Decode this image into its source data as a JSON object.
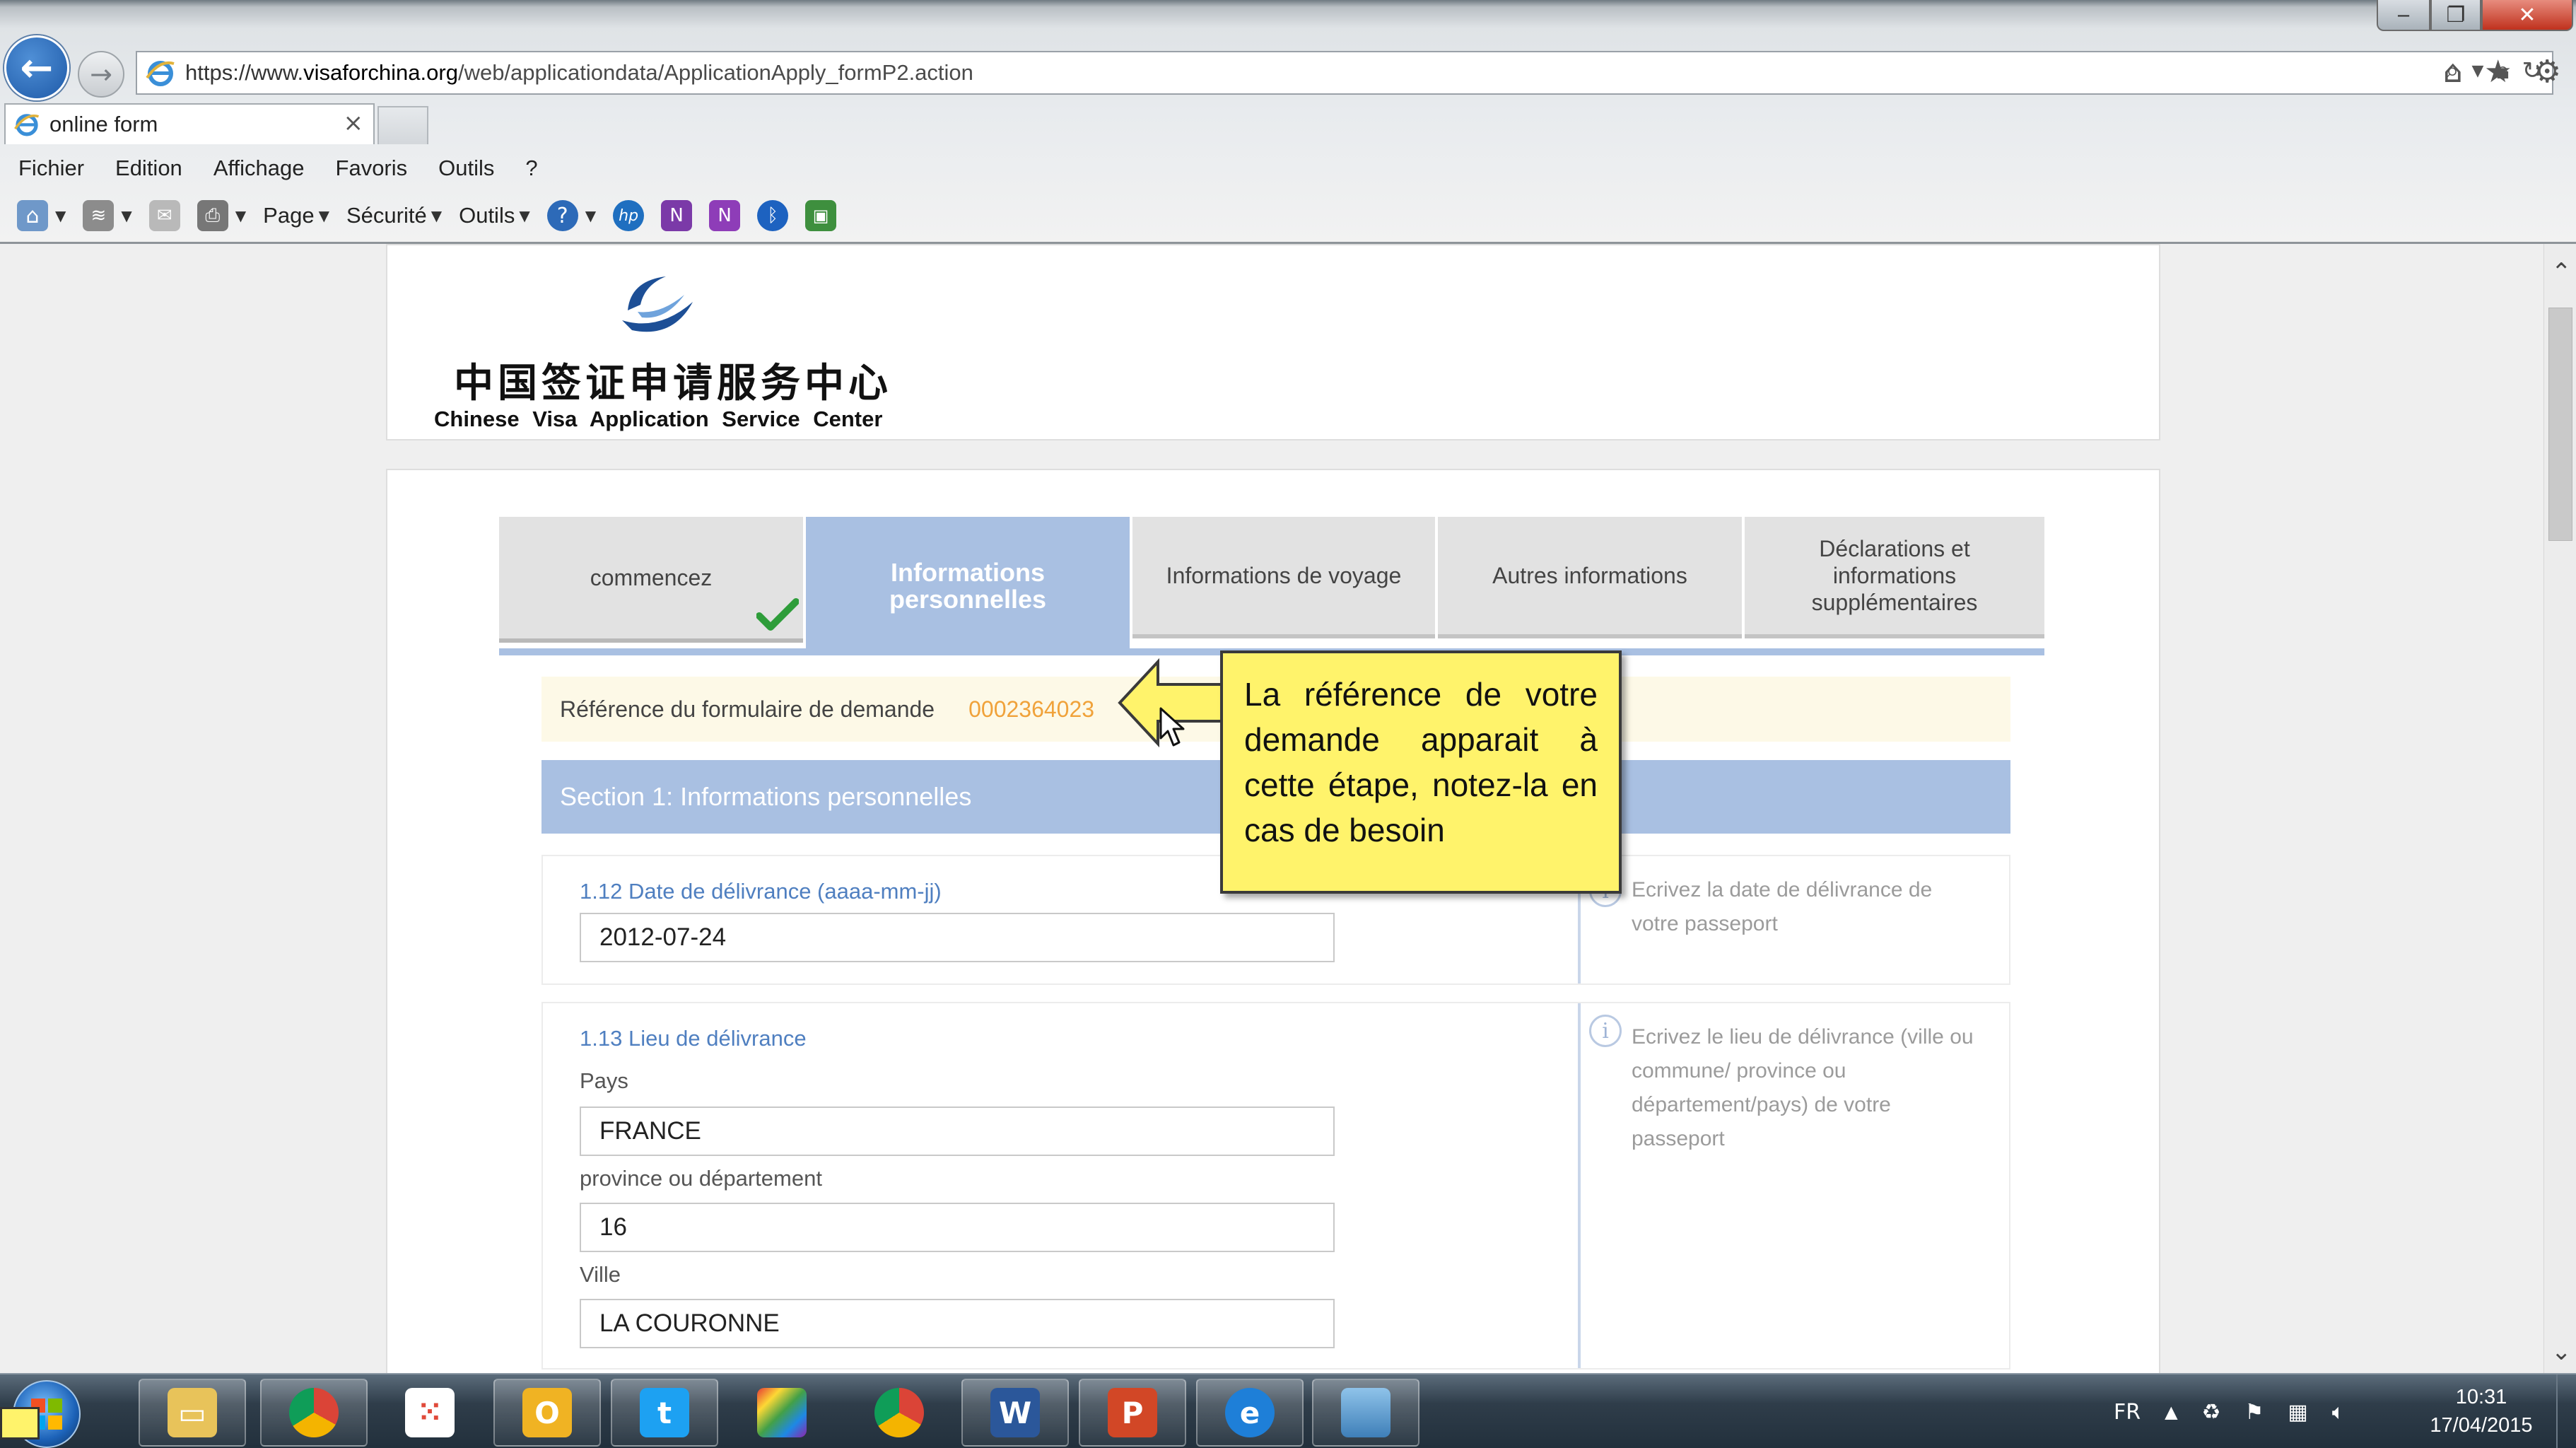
{
  "browser": {
    "url_prefix": "https://www.",
    "url_domain": "visaforchina.org",
    "url_path": "/web/applicationdata/ApplicationApply_formP2.action",
    "tab_title": "online form",
    "menu": [
      "Fichier",
      "Edition",
      "Affichage",
      "Favoris",
      "Outils",
      "?"
    ],
    "toolbar": {
      "page": "Page",
      "security": "Sécurité",
      "tools": "Outils"
    }
  },
  "header": {
    "logo_cn": "中国签证申请服务中心",
    "logo_en": "Chinese Visa Application Service Center"
  },
  "steps": [
    {
      "label": "commencez",
      "state": "done"
    },
    {
      "label": "Informations personnelles",
      "state": "active"
    },
    {
      "label": "Informations de voyage",
      "state": "pending"
    },
    {
      "label": "Autres informations",
      "state": "pending"
    },
    {
      "label": "Déclarations et informations supplémentaires",
      "state": "pending"
    }
  ],
  "reference": {
    "label": "Référence du formulaire de demande",
    "number": "0002364023"
  },
  "section": {
    "title": "Section 1: Informations personnelles"
  },
  "fields": {
    "issue_date": {
      "label": "1.12 Date de délivrance (aaaa-mm-jj)",
      "value": "2012-07-24",
      "help": "Ecrivez la date de délivrance de votre passeport"
    },
    "issue_place": {
      "label": "1.13 Lieu de délivrance",
      "country_label": "Pays",
      "country_value": "FRANCE",
      "province_label": "province ou département",
      "province_value": "16",
      "city_label": "Ville",
      "city_value": "LA COURONNE",
      "help": "Ecrivez le lieu de délivrance (ville ou commune/ province ou département/pays) de votre passeport"
    }
  },
  "callout": {
    "text": "La référence de votre demande apparait à cette étape, notez-la en cas de besoin"
  },
  "taskbar": {
    "language": "FR",
    "time": "10:31",
    "date": "17/04/2015"
  },
  "colors": {
    "accent_blue": "#a9c0e2",
    "reference_orange": "#f0a23a",
    "callout_yellow": "#fff36b",
    "label_blue": "#4f7fc0"
  }
}
